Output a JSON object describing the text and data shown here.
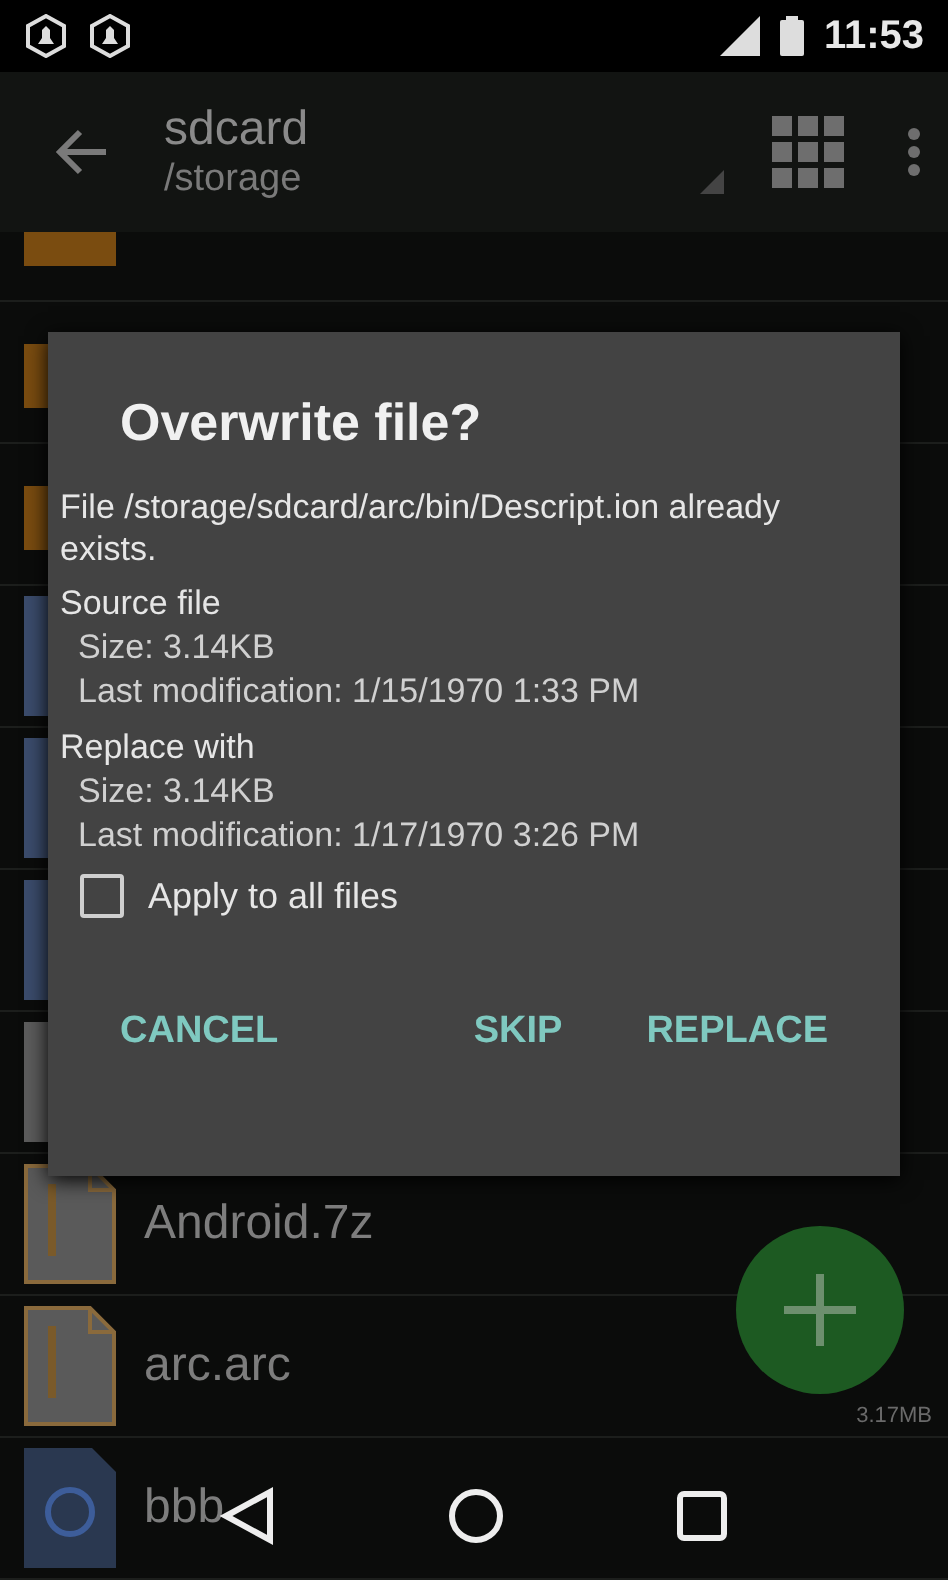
{
  "status_bar": {
    "time": "11:53"
  },
  "toolbar": {
    "title": "sdcard",
    "subtitle": "/storage"
  },
  "files": [
    {
      "kind": "folder"
    },
    {
      "kind": "folder"
    },
    {
      "kind": "folder"
    },
    {
      "kind": "document"
    },
    {
      "kind": "document"
    },
    {
      "kind": "document"
    },
    {
      "kind": "plain"
    },
    {
      "kind": "archive",
      "name": "Android.7z"
    },
    {
      "kind": "archive",
      "name": "arc.arc",
      "size": "3.17MB"
    },
    {
      "kind": "text",
      "name": "bbb"
    }
  ],
  "dialog": {
    "title": "Overwrite file?",
    "message": "File /storage/sdcard/arc/bin/Descript.ion already exists.",
    "sections": [
      {
        "heading": "Source file",
        "lines": [
          "Size: 3.14KB",
          "Last modification: 1/15/1970 1:33 PM"
        ]
      },
      {
        "heading": "Replace with",
        "lines": [
          "Size: 3.14KB",
          "Last modification: 1/17/1970 3:26 PM"
        ]
      }
    ],
    "checkbox": {
      "label": "Apply to all files",
      "checked": false
    },
    "buttons": [
      "CANCEL",
      "SKIP",
      "REPLACE"
    ]
  }
}
